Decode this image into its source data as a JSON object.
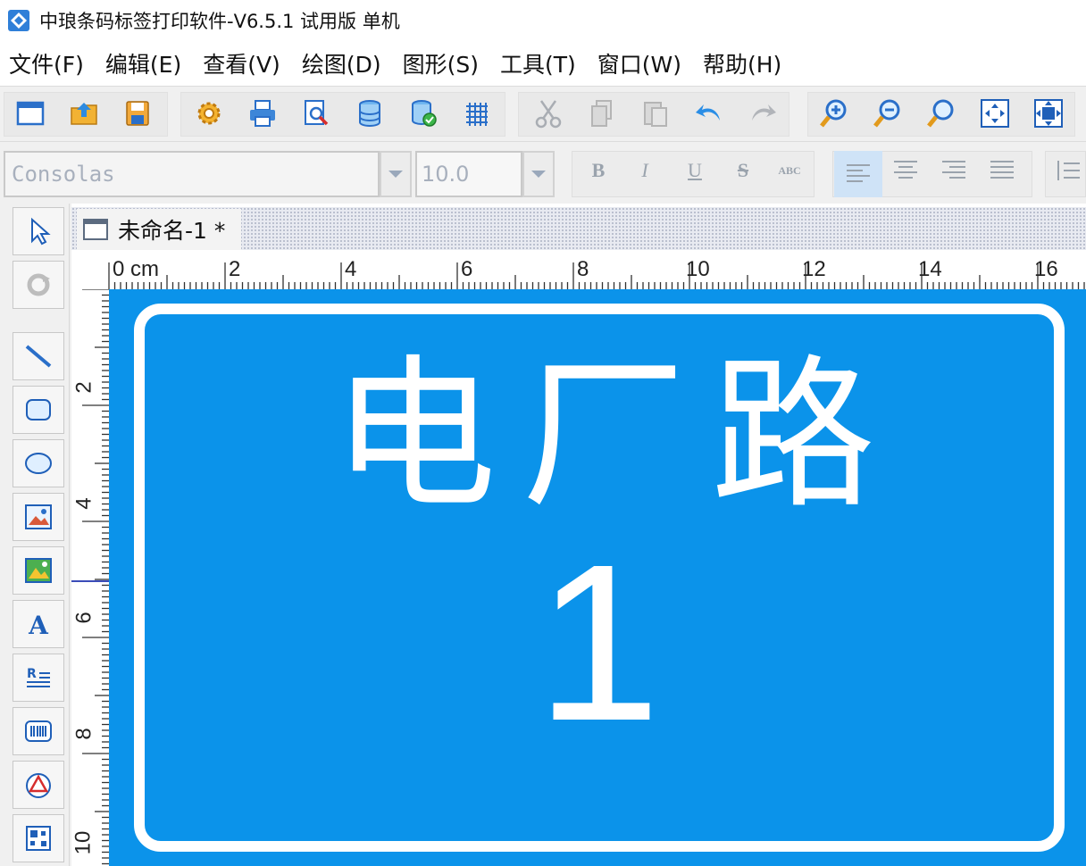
{
  "window": {
    "title": "中琅条码标签打印软件-V6.5.1 试用版 单机"
  },
  "menu": {
    "items": [
      {
        "label": "文件(F)"
      },
      {
        "label": "编辑(E)"
      },
      {
        "label": "查看(V)"
      },
      {
        "label": "绘图(D)"
      },
      {
        "label": "图形(S)"
      },
      {
        "label": "工具(T)"
      },
      {
        "label": "窗口(W)"
      },
      {
        "label": "帮助(H)"
      }
    ]
  },
  "toolbar": {
    "icons": [
      "new-document-icon",
      "open-folder-icon",
      "save-disk-icon",
      "settings-gear-icon",
      "print-icon",
      "print-preview-icon",
      "database-icon",
      "database-connect-icon",
      "grid-icon",
      "cut-icon",
      "copy-icon",
      "paste-icon",
      "undo-icon",
      "redo-icon",
      "zoom-in-icon",
      "zoom-out-icon",
      "zoom-actual-icon",
      "fit-window-icon",
      "fit-page-icon"
    ]
  },
  "format": {
    "font_name": "Consolas",
    "font_size": "10.0",
    "bold": "B",
    "italic": "I",
    "underline": "U",
    "strike": "S",
    "case_label": "ABC"
  },
  "document": {
    "tab_label": "未命名-1 *"
  },
  "ruler": {
    "unit_label": "0 cm",
    "horizontal_ticks": [
      "2",
      "4",
      "6",
      "8",
      "10",
      "12",
      "14",
      "16"
    ],
    "vertical_ticks": [
      "2",
      "4",
      "6",
      "8",
      "10"
    ]
  },
  "label": {
    "background_color": "#0b93ea",
    "text_color": "#ffffff",
    "road_name": "电厂路",
    "number": "1"
  }
}
